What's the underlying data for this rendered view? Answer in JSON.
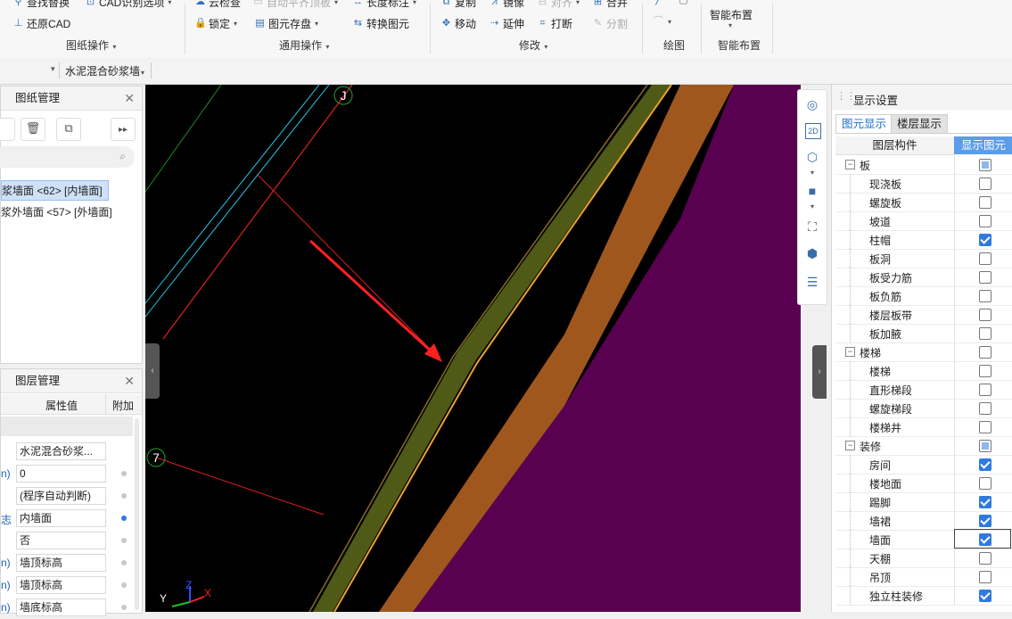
{
  "ribbon": {
    "find_replace": "查找替换",
    "cad_options": "CAD识别选项",
    "restore_cad": "还原CAD",
    "cloud_check": "云检查",
    "auto_flat_slab": "自动平齐顶板",
    "length_dim": "长度标注",
    "lock": "锁定",
    "save_element": "图元存盘",
    "convert_element": "转换图元",
    "copy": "复制",
    "mirror": "镜像",
    "align": "对齐",
    "merge": "合并",
    "move": "移动",
    "extend": "延伸",
    "break": "打断",
    "split": "分割",
    "smart_layout": "智能布置",
    "groups": {
      "drawing_ops": "图纸操作",
      "common_ops": "通用操作",
      "modify": "修改",
      "draw": "绘图",
      "smart_layout": "智能布置"
    }
  },
  "toolbar2": {
    "material": "水泥混合砂浆墙"
  },
  "drawing_panel": {
    "title": "图纸管理",
    "items": [
      "浆墙面 <62> [内墙面]",
      "浆外墙面 <57> [外墙面]"
    ]
  },
  "layer_panel": {
    "title": "图层管理",
    "col_value": "属性值",
    "col_extra": "附加",
    "rows": [
      {
        "label": "",
        "value": "水泥混合砂浆...",
        "dot": "none"
      },
      {
        "label": "n)",
        "value": "0",
        "dot": "grey"
      },
      {
        "label": "",
        "value": "(程序自动判断)",
        "dot": "grey"
      },
      {
        "label": "志",
        "value": "内墙面",
        "dot": "blue"
      },
      {
        "label": "",
        "value": "否",
        "dot": "grey"
      },
      {
        "label": "n)",
        "value": "墙顶标高",
        "dot": "grey"
      },
      {
        "label": "n)",
        "value": "墙顶标高",
        "dot": "grey"
      },
      {
        "label": "n)",
        "value": "墙底标高",
        "dot": "grey"
      }
    ]
  },
  "canvas": {
    "axis_j": "J",
    "axis_7": "7",
    "axes_y": "Y",
    "axes_z": "Z",
    "axes_x": "X",
    "colors": {
      "bg": "#000000",
      "purple": "#5a0050",
      "orange": "#a0571e",
      "olive": "#4f5a16",
      "red": "#ff2020",
      "cyan": "#28c8e8"
    }
  },
  "display_panel": {
    "title": "显示设置",
    "tabs": [
      "图元显示",
      "楼层显示"
    ],
    "col_component": "图层构件",
    "col_show": "显示图元",
    "rows": [
      {
        "name": "板",
        "level": 0,
        "state": "partial",
        "group": true
      },
      {
        "name": "现浇板",
        "level": 1,
        "state": "off"
      },
      {
        "name": "螺旋板",
        "level": 1,
        "state": "off"
      },
      {
        "name": "坡道",
        "level": 1,
        "state": "off"
      },
      {
        "name": "柱帽",
        "level": 1,
        "state": "on"
      },
      {
        "name": "板洞",
        "level": 1,
        "state": "off"
      },
      {
        "name": "板受力筋",
        "level": 1,
        "state": "off"
      },
      {
        "name": "板负筋",
        "level": 1,
        "state": "off"
      },
      {
        "name": "楼层板带",
        "level": 1,
        "state": "off"
      },
      {
        "name": "板加腋",
        "level": 1,
        "state": "off"
      },
      {
        "name": "楼梯",
        "level": 0,
        "state": "off",
        "group": true
      },
      {
        "name": "楼梯",
        "level": 1,
        "state": "off"
      },
      {
        "name": "直形梯段",
        "level": 1,
        "state": "off"
      },
      {
        "name": "螺旋梯段",
        "level": 1,
        "state": "off"
      },
      {
        "name": "楼梯井",
        "level": 1,
        "state": "off"
      },
      {
        "name": "装修",
        "level": 0,
        "state": "partial",
        "group": true
      },
      {
        "name": "房间",
        "level": 1,
        "state": "on"
      },
      {
        "name": "楼地面",
        "level": 1,
        "state": "off"
      },
      {
        "name": "踢脚",
        "level": 1,
        "state": "on"
      },
      {
        "name": "墙裙",
        "level": 1,
        "state": "on"
      },
      {
        "name": "墙面",
        "level": 1,
        "state": "on",
        "selected": true
      },
      {
        "name": "天棚",
        "level": 1,
        "state": "off"
      },
      {
        "name": "吊顶",
        "level": 1,
        "state": "off"
      },
      {
        "name": "独立柱装修",
        "level": 1,
        "state": "on"
      }
    ]
  }
}
